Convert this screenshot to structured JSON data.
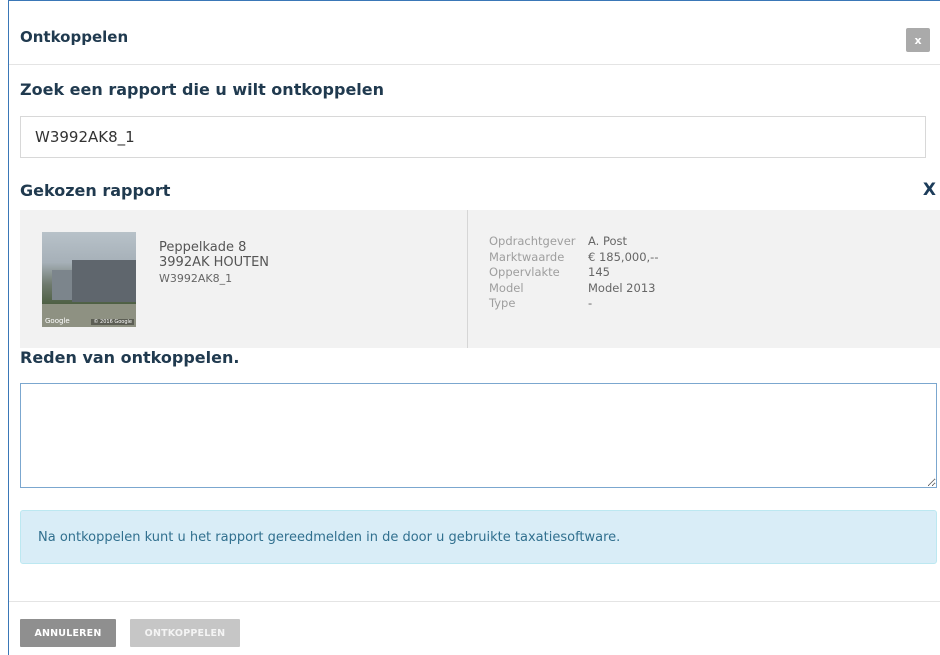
{
  "dialog": {
    "title": "Ontkoppelen",
    "close_label": "x"
  },
  "search": {
    "label": "Zoek een rapport die u wilt ontkoppelen",
    "value": "W3992AK8_1"
  },
  "chosen": {
    "label": "Gekozen rapport",
    "remove_label": "X",
    "photo": {
      "brand": "Google",
      "copyright": "© 2016 Google"
    },
    "address": {
      "street": "Peppelkade 8",
      "city": "3992AK HOUTEN",
      "code": "W3992AK8_1"
    },
    "details": [
      {
        "key": "Opdrachtgever",
        "value": "A. Post"
      },
      {
        "key": "Marktwaarde",
        "value": "€ 185,000,--"
      },
      {
        "key": "Oppervlakte",
        "value": "145"
      },
      {
        "key": "Model",
        "value": "Model 2013"
      },
      {
        "key": "Type",
        "value": "-"
      }
    ]
  },
  "reason": {
    "label": "Reden van ontkoppelen.",
    "value": ""
  },
  "info": {
    "text": "Na ontkoppelen kunt u het rapport gereedmelden in de door u gebruikte taxatiesoftware."
  },
  "footer": {
    "cancel_label": "ANNULEREN",
    "unlink_label": "ONTKOPPELEN"
  },
  "colors": {
    "heading": "#203a4f",
    "info_bg": "#d9edf7",
    "info_text": "#31708f",
    "cancel_bg": "#8f8f8f",
    "disabled_bg": "#c6c6c6"
  }
}
